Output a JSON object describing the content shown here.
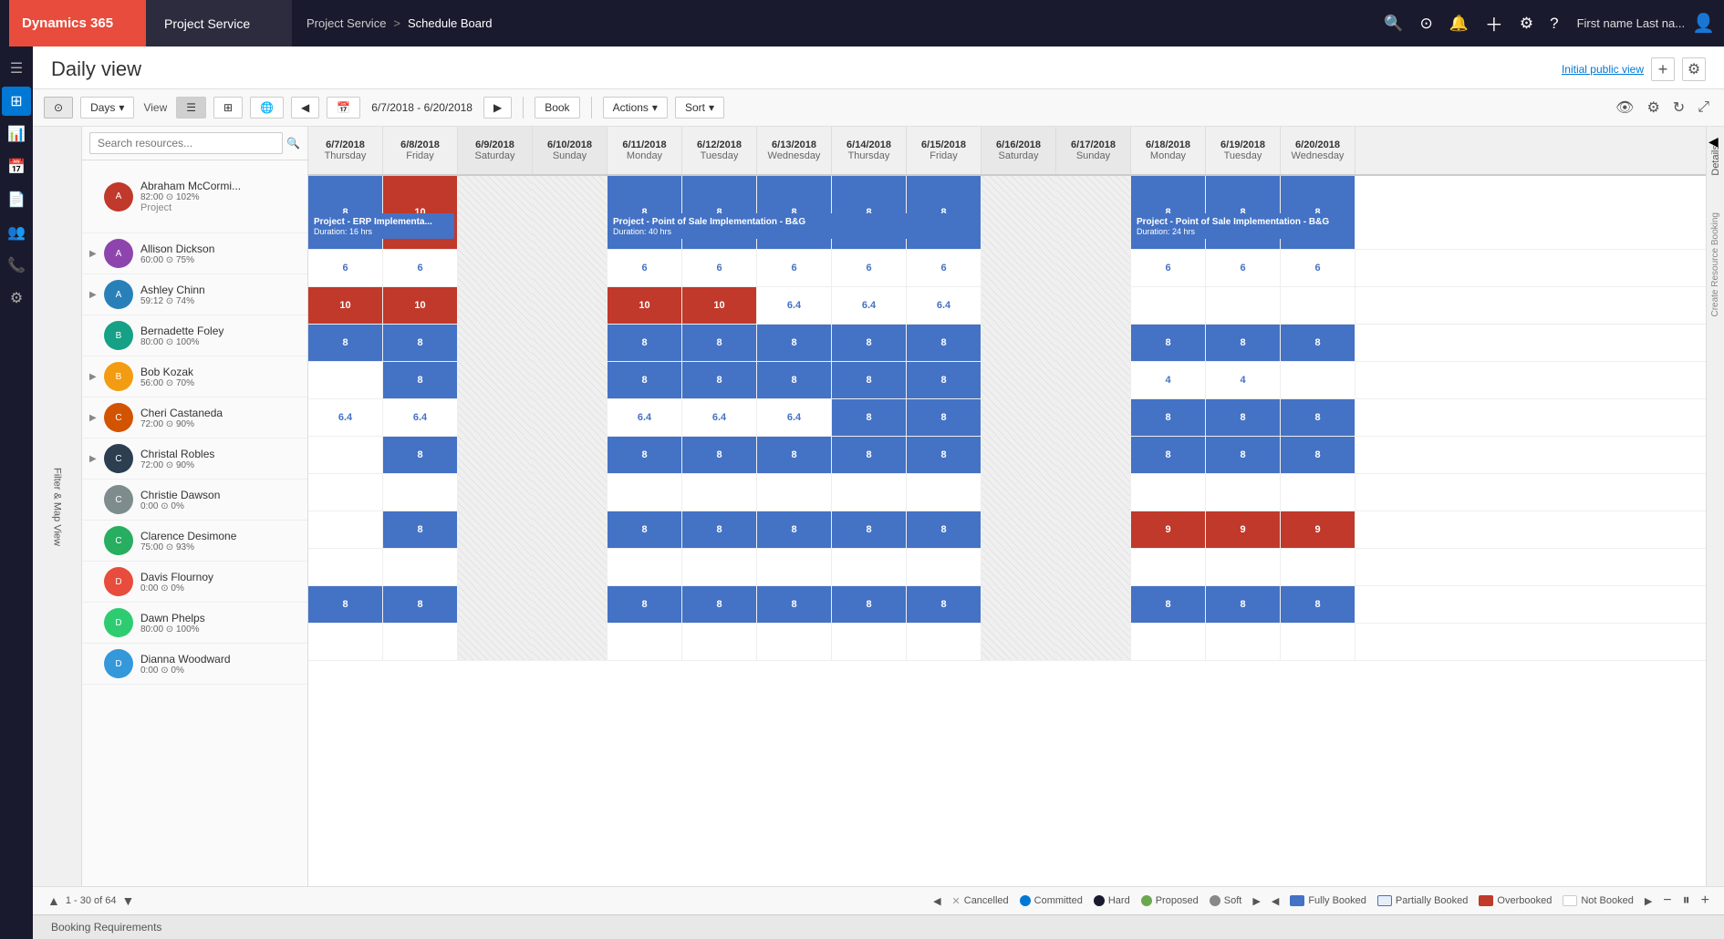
{
  "topnav": {
    "d365": "Dynamics 365",
    "ps": "Project Service",
    "breadcrumb1": "Project Service",
    "breadcrumb_sep": ">",
    "breadcrumb2": "Schedule Board",
    "user": "First name Last na...",
    "icons": [
      "🔍",
      "⊙",
      "🔔",
      "＋",
      "⚙",
      "?"
    ]
  },
  "page": {
    "title": "Daily view",
    "public_view_label": "Initial public view",
    "add_label": "+"
  },
  "toolbar": {
    "days_label": "Days",
    "view_label": "View",
    "date_range": "6/7/2018 - 6/20/2018",
    "book_label": "Book",
    "actions_label": "Actions",
    "sort_label": "Sort"
  },
  "filter_sidebar": "Filter & Map View",
  "search": {
    "placeholder": "Search resources..."
  },
  "columns": [
    {
      "date": "6/7/2018",
      "day": "Thursday"
    },
    {
      "date": "6/8/2018",
      "day": "Friday"
    },
    {
      "date": "6/9/2018",
      "day": "Saturday"
    },
    {
      "date": "6/10/2018",
      "day": "Sunday"
    },
    {
      "date": "6/11/2018",
      "day": "Monday"
    },
    {
      "date": "6/12/2018",
      "day": "Tuesday"
    },
    {
      "date": "6/13/2018",
      "day": "Wednesday"
    },
    {
      "date": "6/14/2018",
      "day": "Thursday"
    },
    {
      "date": "6/15/2018",
      "day": "Friday"
    },
    {
      "date": "6/16/2018",
      "day": "Saturday"
    },
    {
      "date": "6/17/2018",
      "day": "Sunday"
    },
    {
      "date": "6/18/2018",
      "day": "Monday"
    },
    {
      "date": "6/19/2018",
      "day": "Tuesday"
    },
    {
      "date": "6/20/2018",
      "day": "Wednesday"
    }
  ],
  "resources": [
    {
      "name": "Abraham McCormi...",
      "meta": "82:00  ⊙  102%",
      "sub": "Project",
      "cells": [
        "8",
        "10",
        "",
        "",
        "8",
        "8",
        "8",
        "8",
        "8",
        "",
        "",
        "8",
        "8",
        "8"
      ],
      "types": [
        "hard",
        "overbooked",
        "weekend",
        "weekend",
        "hard",
        "hard",
        "hard",
        "hard",
        "hard",
        "weekend",
        "weekend",
        "hard",
        "hard",
        "hard"
      ],
      "project1": {
        "label": "Project - ERP Implementa...",
        "duration": "Duration: 16 hrs",
        "start": 0,
        "span": 2
      },
      "project2": {
        "label": "Project - Point of Sale Implementation - B&G",
        "duration": "Duration: 40 hrs",
        "start": 4,
        "span": 5
      },
      "project3": {
        "label": "Project - Point of Sale Implementation - B&G",
        "duration": "Duration: 24 hrs",
        "start": 11,
        "span": 3
      }
    },
    {
      "name": "Allison Dickson",
      "meta": "60:00  ⊙  75%",
      "sub": "",
      "cells": [
        "6",
        "6",
        "",
        "",
        "6",
        "6",
        "6",
        "6",
        "6",
        "",
        "",
        "6",
        "6",
        "6"
      ],
      "types": [
        "partial",
        "partial",
        "weekend",
        "weekend",
        "partial",
        "partial",
        "partial",
        "partial",
        "partial",
        "weekend",
        "weekend",
        "partial",
        "partial",
        "partial"
      ]
    },
    {
      "name": "Ashley Chinn",
      "meta": "59:12  ⊙  74%",
      "sub": "",
      "cells": [
        "10",
        "10",
        "",
        "",
        "10",
        "10",
        "6.4",
        "6.4",
        "6.4",
        "",
        "",
        "",
        "",
        ""
      ],
      "types": [
        "overbooked",
        "overbooked",
        "weekend",
        "weekend",
        "overbooked",
        "overbooked",
        "partial",
        "partial",
        "partial",
        "weekend",
        "weekend",
        "",
        "",
        ""
      ]
    },
    {
      "name": "Bernadette Foley",
      "meta": "80:00  ⊙  100%",
      "sub": "",
      "cells": [
        "8",
        "8",
        "",
        "",
        "8",
        "8",
        "8",
        "8",
        "8",
        "",
        "",
        "8",
        "8",
        "8"
      ],
      "types": [
        "hard",
        "hard",
        "weekend",
        "weekend",
        "hard",
        "hard",
        "hard",
        "hard",
        "hard",
        "weekend",
        "weekend",
        "hard",
        "hard",
        "hard"
      ]
    },
    {
      "name": "Bob Kozak",
      "meta": "56:00  ⊙  70%",
      "sub": "",
      "cells": [
        "",
        "8",
        "",
        "",
        "8",
        "8",
        "8",
        "8",
        "8",
        "",
        "",
        "4",
        "4",
        ""
      ],
      "types": [
        "",
        "hard",
        "weekend",
        "weekend",
        "hard",
        "hard",
        "hard",
        "hard",
        "hard",
        "weekend",
        "weekend",
        "partial",
        "partial",
        ""
      ]
    },
    {
      "name": "Cheri Castaneda",
      "meta": "72:00  ⊙  90%",
      "sub": "",
      "cells": [
        "6.4",
        "6.4",
        "",
        "",
        "6.4",
        "6.4",
        "6.4",
        "8",
        "8",
        "",
        "",
        "8",
        "8",
        "8"
      ],
      "types": [
        "partial",
        "partial",
        "weekend",
        "weekend",
        "partial",
        "partial",
        "partial",
        "hard",
        "hard",
        "weekend",
        "weekend",
        "hard",
        "hard",
        "hard"
      ]
    },
    {
      "name": "Christal Robles",
      "meta": "72:00  ⊙  90%",
      "sub": "",
      "cells": [
        "",
        "8",
        "",
        "",
        "8",
        "8",
        "8",
        "8",
        "8",
        "",
        "",
        "8",
        "8",
        "8"
      ],
      "types": [
        "",
        "hard",
        "weekend",
        "weekend",
        "hard",
        "hard",
        "hard",
        "hard",
        "hard",
        "weekend",
        "weekend",
        "hard",
        "hard",
        "hard"
      ]
    },
    {
      "name": "Christie Dawson",
      "meta": "0:00  ⊙  0%",
      "sub": "",
      "cells": [
        "",
        "",
        "",
        "",
        "",
        "",
        "",
        "",
        "",
        "",
        "",
        "",
        "",
        ""
      ],
      "types": [
        "",
        "",
        "weekend",
        "weekend",
        "",
        "",
        "",
        "",
        "",
        "weekend",
        "weekend",
        "",
        "",
        ""
      ]
    },
    {
      "name": "Clarence Desimone",
      "meta": "75:00  ⊙  93%",
      "sub": "",
      "cells": [
        "",
        "8",
        "",
        "",
        "8",
        "8",
        "8",
        "8",
        "8",
        "",
        "",
        "9",
        "9",
        "9"
      ],
      "types": [
        "",
        "hard",
        "weekend",
        "weekend",
        "hard",
        "hard",
        "hard",
        "hard",
        "hard",
        "weekend",
        "weekend",
        "overbooked",
        "overbooked",
        "overbooked"
      ]
    },
    {
      "name": "Davis Flournoy",
      "meta": "0:00  ⊙  0%",
      "sub": "",
      "cells": [
        "",
        "",
        "",
        "",
        "",
        "",
        "",
        "",
        "",
        "",
        "",
        "",
        "",
        ""
      ],
      "types": [
        "",
        "",
        "weekend",
        "weekend",
        "",
        "",
        "",
        "",
        "",
        "weekend",
        "weekend",
        "",
        "",
        ""
      ]
    },
    {
      "name": "Dawn Phelps",
      "meta": "80:00  ⊙  100%",
      "sub": "",
      "cells": [
        "8",
        "8",
        "",
        "",
        "8",
        "8",
        "8",
        "8",
        "8",
        "",
        "",
        "8",
        "8",
        "8"
      ],
      "types": [
        "hard",
        "hard",
        "weekend",
        "weekend",
        "hard",
        "hard",
        "hard",
        "hard",
        "hard",
        "weekend",
        "weekend",
        "hard",
        "hard",
        "hard"
      ]
    },
    {
      "name": "Dianna Woodward",
      "meta": "0:00  ⊙  0%",
      "sub": "",
      "cells": [
        "",
        "",
        "",
        "",
        "",
        "",
        "",
        "",
        "",
        "",
        "",
        "",
        "",
        ""
      ],
      "types": [
        "",
        "",
        "weekend",
        "weekend",
        "",
        "",
        "",
        "",
        "",
        "weekend",
        "weekend",
        "",
        "",
        ""
      ]
    }
  ],
  "bottom": {
    "pagination": "1 - 30 of 64",
    "legend": {
      "cancelled": "Cancelled",
      "committed": "Committed",
      "hard": "Hard",
      "proposed": "Proposed",
      "soft": "Soft",
      "fully_booked": "Fully Booked",
      "partially_booked": "Partially Booked",
      "overbooked": "Overbooked",
      "not_booked": "Not Booked"
    }
  },
  "booking_req": "Booking Requirements",
  "details_panel": "Details",
  "create_booking": "Create Resource Booking"
}
